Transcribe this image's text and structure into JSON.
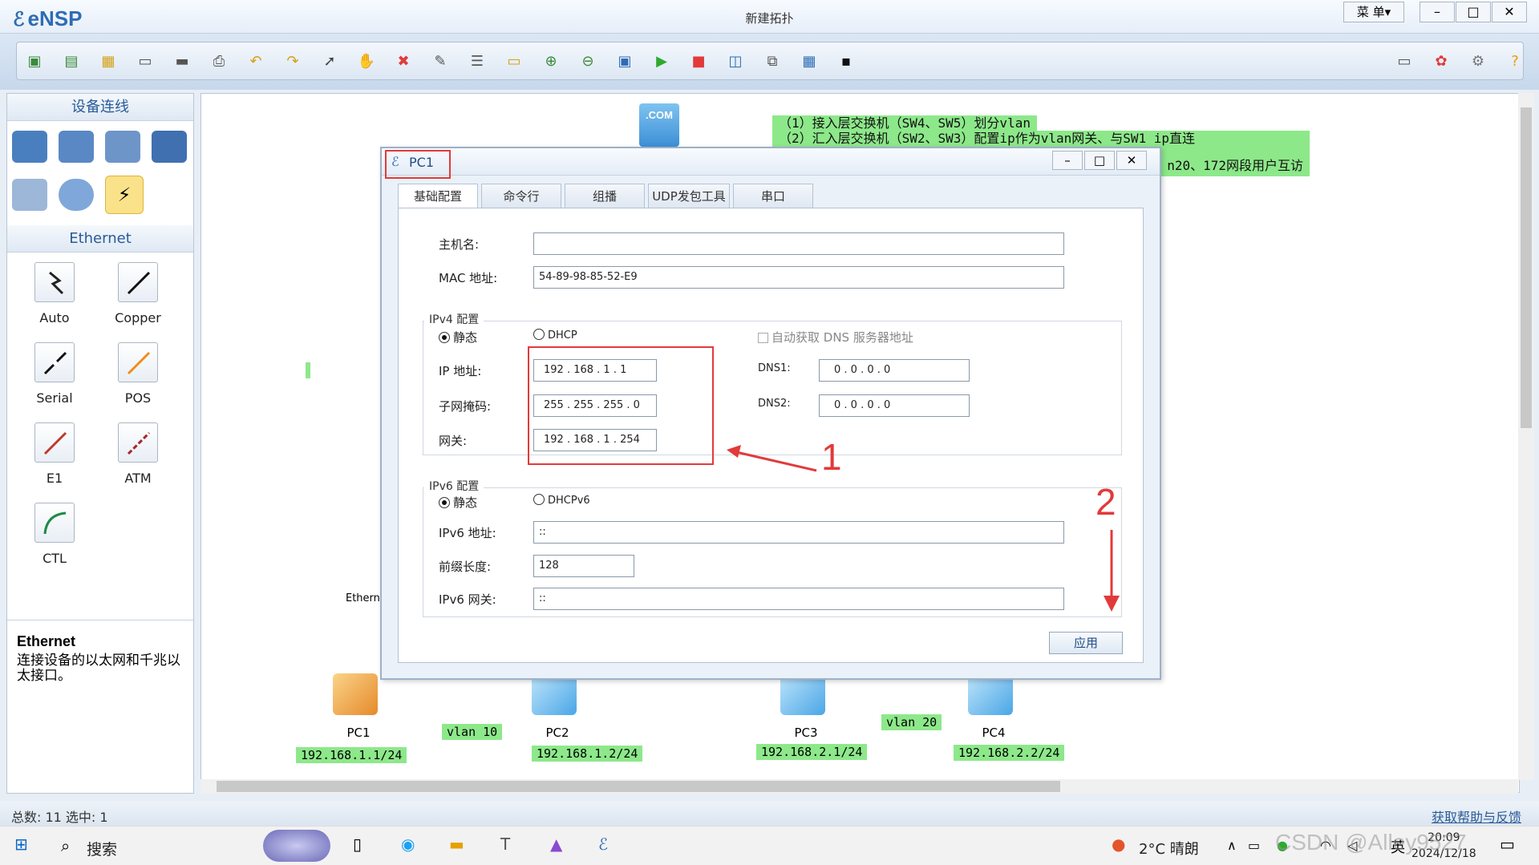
{
  "app": {
    "logo": "eNSP",
    "title": "新建拓扑",
    "menu": "菜 单▾"
  },
  "window_controls": {
    "minimize": "–",
    "maximize": "□",
    "close": "✕"
  },
  "toolbar": {
    "icons": [
      "new-topology",
      "new-project",
      "open",
      "save",
      "save-as",
      "print",
      "undo",
      "redo",
      "select",
      "pan",
      "delete",
      "delete-link",
      "text",
      "palette",
      "zoom-in",
      "zoom-out",
      "fit",
      "start",
      "stop",
      "capture",
      "topology",
      "table",
      "terminal",
      "message",
      "huawei",
      "settings",
      "help"
    ]
  },
  "left_panel": {
    "devices_header": "设备连线",
    "cables_header": "Ethernet",
    "cables": [
      {
        "label": "Auto",
        "color": "#222222"
      },
      {
        "label": "Copper",
        "color": "#111111"
      },
      {
        "label": "Serial",
        "color": "#111111"
      },
      {
        "label": "POS",
        "color": "#f08c1c"
      },
      {
        "label": "E1",
        "color": "#c0392b"
      },
      {
        "label": "ATM",
        "color": "#a6282a"
      },
      {
        "label": "CTL",
        "color": "#1e8a4a"
      }
    ],
    "desc_title": "Ethernet",
    "desc_text": "连接设备的以太网和千兆以太接口。"
  },
  "canvas": {
    "notes": [
      "（1）接入层交换机（SW4、SW5）划分vlan",
      "（2）汇入层交换机（SW2、SW3）配置ip作为vlan网关、与SW1 ip直连",
      "n20、172网段用户互访"
    ],
    "com_label": ".COM",
    "ether_label": "Ethern",
    "pcs": [
      {
        "name": "PC1",
        "ip": "192.168.1.1/24"
      },
      {
        "name": "PC2",
        "ip": "192.168.1.2/24"
      },
      {
        "name": "PC3",
        "ip": "192.168.2.1/24"
      },
      {
        "name": "PC4",
        "ip": "192.168.2.2/24"
      }
    ],
    "vlan_tags": [
      "vlan 10",
      "vlan 20"
    ]
  },
  "dialog": {
    "title": "PC1",
    "tabs": [
      "基础配置",
      "命令行",
      "组播",
      "UDP发包工具",
      "串口"
    ],
    "hostname_label": "主机名:",
    "hostname_value": "",
    "mac_label": "MAC 地址:",
    "mac_value": "54-89-98-85-52-E9",
    "ipv4_group": "IPv4 配置",
    "static_label": "静态",
    "dhcp_label": "DHCP",
    "auto_dns_label": "自动获取 DNS 服务器地址",
    "ip_label": "IP 地址:",
    "ip_value": "192  .  168  .    1    .    1",
    "mask_label": "子网掩码:",
    "mask_value": "255  .  255  .  255  .    0",
    "gw_label": "网关:",
    "gw_value": "192  .  168  .    1    .  254",
    "dns1_label": "DNS1:",
    "dns1_value": "0    .    0    .    0    .    0",
    "dns2_label": "DNS2:",
    "dns2_value": "0    .    0    .    0    .    0",
    "ipv6_group": "IPv6 配置",
    "static6_label": "静态",
    "dhcpv6_label": "DHCPv6",
    "ipv6_label": "IPv6 地址:",
    "ipv6_value": "::",
    "prefix_label": "前缀长度:",
    "prefix_value": "128",
    "gw6_label": "IPv6 网关:",
    "gw6_value": "::",
    "apply_label": "应用",
    "annotation_1": "1",
    "annotation_2": "2"
  },
  "status": {
    "left": "总数: 11  选中: 1",
    "right": "获取帮助与反馈"
  },
  "taskbar": {
    "search": "搜索",
    "weather": "2°C  晴朗",
    "ime": "英",
    "time": "20:09",
    "date": "2024/12/18",
    "watermark": "CSDN @Alley9527"
  }
}
